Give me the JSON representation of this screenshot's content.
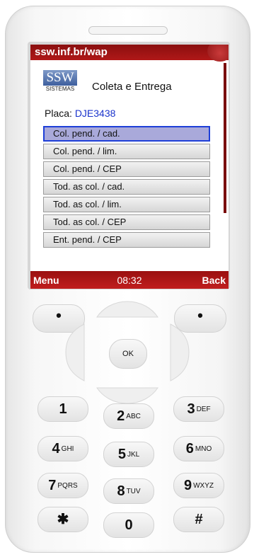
{
  "screen": {
    "title": "ssw.inf.br/wap",
    "logo": {
      "main": "SSW",
      "sub": "SISTEMAS"
    },
    "app_title": "Coleta e Entrega",
    "plate": {
      "label": "Placa: ",
      "value": "DJE3438"
    },
    "menu_items": [
      "Col. pend. / cad.",
      "Col. pend. / lim.",
      "Col. pend. / CEP",
      "Tod. as col. / cad.",
      "Tod. as col. / lim.",
      "Tod. as col. / CEP",
      "Ent. pend. / CEP"
    ],
    "selected_index": 0,
    "softbar": {
      "left": "Menu",
      "time": "08:32",
      "right": "Back"
    }
  },
  "keypad": {
    "ok_label": "OK",
    "soft_left": "•",
    "soft_right": "•",
    "keys": [
      {
        "main": "1",
        "sub": ""
      },
      {
        "main": "2",
        "sub": "ABC"
      },
      {
        "main": "3",
        "sub": "DEF"
      },
      {
        "main": "4",
        "sub": "GHI"
      },
      {
        "main": "5",
        "sub": "JKL"
      },
      {
        "main": "6",
        "sub": "MNO"
      },
      {
        "main": "7",
        "sub": "PQRS"
      },
      {
        "main": "8",
        "sub": "TUV"
      },
      {
        "main": "9",
        "sub": "WXYZ"
      },
      {
        "main": "✱",
        "sub": ""
      },
      {
        "main": "0",
        "sub": ""
      },
      {
        "main": "#",
        "sub": ""
      }
    ]
  },
  "colors": {
    "accent": "#b01818",
    "selection": "#1e3fd8",
    "plate_value": "#1a33cc"
  }
}
